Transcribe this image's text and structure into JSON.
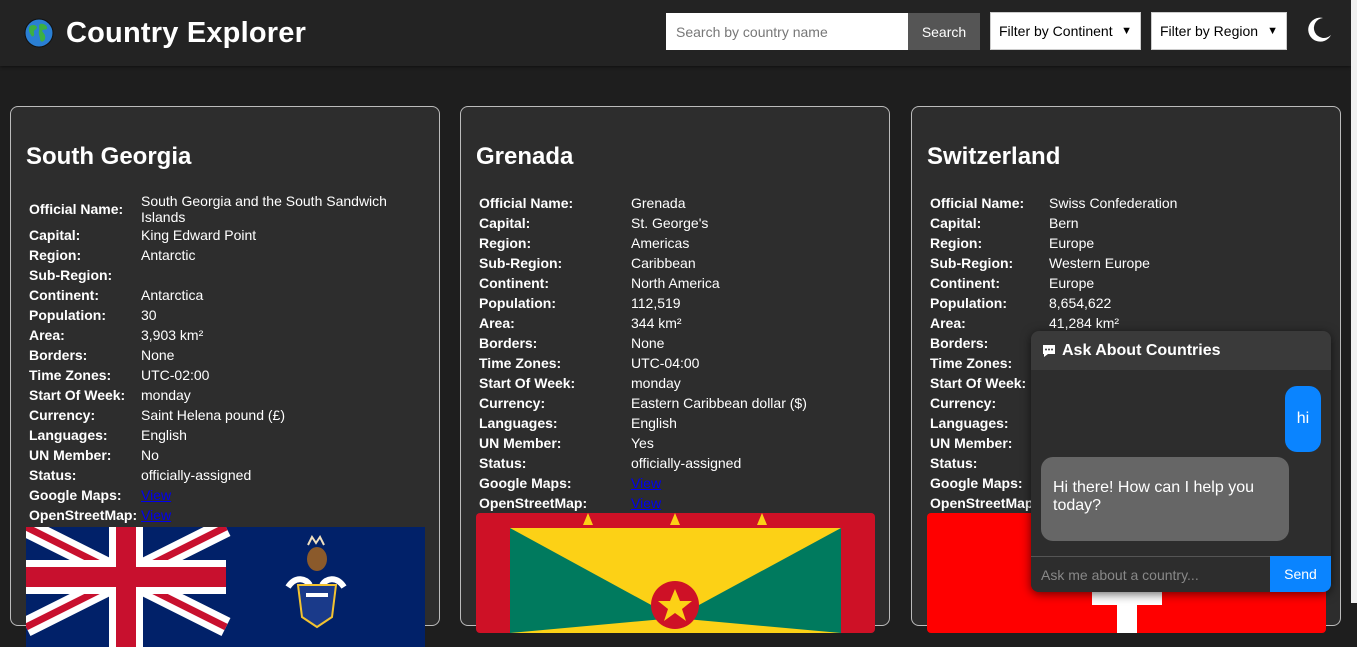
{
  "header": {
    "title": "Country Explorer",
    "search_placeholder": "Search by country name",
    "search_button": "Search",
    "continent_filter": "Filter by Continent",
    "region_filter": "Filter by Region"
  },
  "countries": [
    {
      "name": "South Georgia",
      "rows": [
        {
          "k": "Official Name:",
          "v": "South Georgia and the South Sandwich Islands"
        },
        {
          "k": "Capital:",
          "v": "King Edward Point"
        },
        {
          "k": "Region:",
          "v": "Antarctic"
        },
        {
          "k": "Sub-Region:",
          "v": ""
        },
        {
          "k": "Continent:",
          "v": "Antarctica"
        },
        {
          "k": "Population:",
          "v": "30"
        },
        {
          "k": "Area:",
          "v": "3,903 km²"
        },
        {
          "k": "Borders:",
          "v": "None"
        },
        {
          "k": "Time Zones:",
          "v": "UTC-02:00"
        },
        {
          "k": "Start Of Week:",
          "v": "monday"
        },
        {
          "k": "Currency:",
          "v": "Saint Helena pound (£)"
        },
        {
          "k": "Languages:",
          "v": "English"
        },
        {
          "k": "UN Member:",
          "v": "No"
        },
        {
          "k": "Status:",
          "v": "officially-assigned"
        },
        {
          "k": "Google Maps:",
          "v": "View"
        },
        {
          "k": "OpenStreetMap:",
          "v": "View"
        }
      ]
    },
    {
      "name": "Grenada",
      "rows": [
        {
          "k": "Official Name:",
          "v": "Grenada"
        },
        {
          "k": "Capital:",
          "v": "St. George's"
        },
        {
          "k": "Region:",
          "v": "Americas"
        },
        {
          "k": "Sub-Region:",
          "v": "Caribbean"
        },
        {
          "k": "Continent:",
          "v": "North America"
        },
        {
          "k": "Population:",
          "v": "112,519"
        },
        {
          "k": "Area:",
          "v": "344 km²"
        },
        {
          "k": "Borders:",
          "v": "None"
        },
        {
          "k": "Time Zones:",
          "v": "UTC-04:00"
        },
        {
          "k": "Start Of Week:",
          "v": "monday"
        },
        {
          "k": "Currency:",
          "v": "Eastern Caribbean dollar ($)"
        },
        {
          "k": "Languages:",
          "v": "English"
        },
        {
          "k": "UN Member:",
          "v": "Yes"
        },
        {
          "k": "Status:",
          "v": "officially-assigned"
        },
        {
          "k": "Google Maps:",
          "v": "View"
        },
        {
          "k": "OpenStreetMap:",
          "v": "View"
        }
      ]
    },
    {
      "name": "Switzerland",
      "rows": [
        {
          "k": "Official Name:",
          "v": "Swiss Confederation"
        },
        {
          "k": "Capital:",
          "v": "Bern"
        },
        {
          "k": "Region:",
          "v": "Europe"
        },
        {
          "k": "Sub-Region:",
          "v": "Western Europe"
        },
        {
          "k": "Continent:",
          "v": "Europe"
        },
        {
          "k": "Population:",
          "v": "8,654,622"
        },
        {
          "k": "Area:",
          "v": "41,284 km²"
        },
        {
          "k": "Borders:",
          "v": ""
        },
        {
          "k": "Time Zones:",
          "v": ""
        },
        {
          "k": "Start Of Week:",
          "v": ""
        },
        {
          "k": "Currency:",
          "v": ""
        },
        {
          "k": "Languages:",
          "v": ""
        },
        {
          "k": "UN Member:",
          "v": ""
        },
        {
          "k": "Status:",
          "v": ""
        },
        {
          "k": "Google Maps:",
          "v": ""
        },
        {
          "k": "OpenStreetMap:",
          "v": ""
        }
      ]
    }
  ],
  "chat": {
    "title": "Ask About Countries",
    "user_message": "hi",
    "bot_message": "Hi there! How can I help you today?",
    "input_placeholder": "Ask me about a country...",
    "send_label": "Send"
  },
  "colors": {
    "background": "#1e1e1e",
    "card": "#2d2d2d",
    "accent": "#0a84ff",
    "link": "#0000ee"
  },
  "icons": {
    "logo": "globe-icon",
    "theme": "moon-icon",
    "chat": "speech-bubble-icon"
  }
}
